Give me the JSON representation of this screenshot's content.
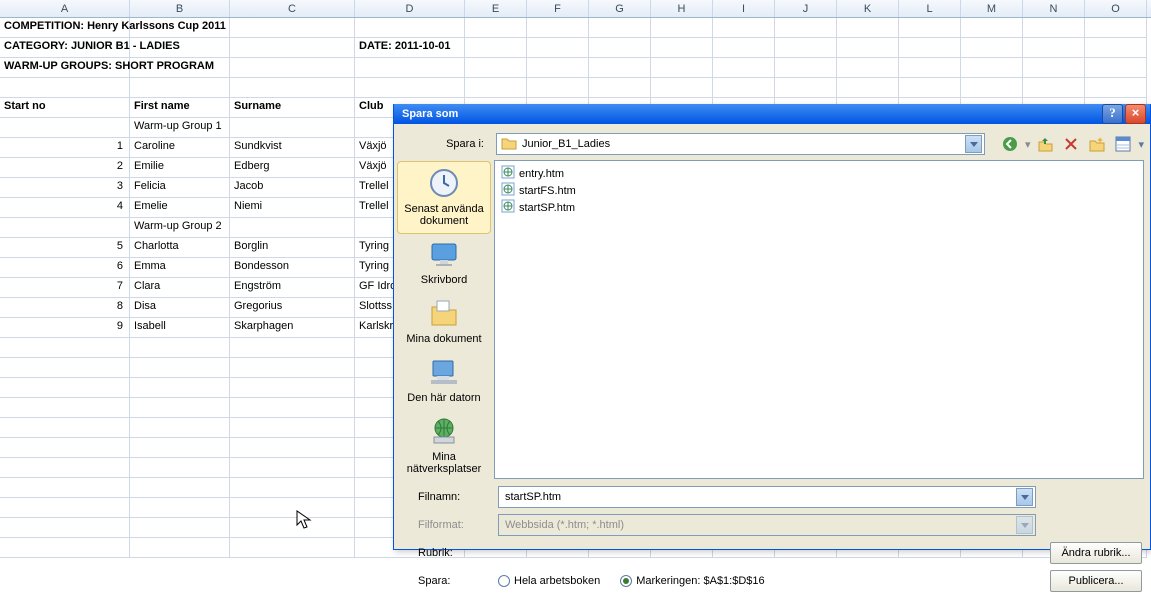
{
  "columns": [
    "A",
    "B",
    "C",
    "D",
    "E",
    "F",
    "G",
    "H",
    "I",
    "J",
    "K",
    "L",
    "M",
    "N",
    "O"
  ],
  "sheet": {
    "r1": {
      "a": "COMPETITION: Henry Karlssons Cup 2011"
    },
    "r2": {
      "a": "CATEGORY: JUNIOR B1 - LADIES",
      "d": "DATE: 2011-10-01"
    },
    "r3": {
      "a": "WARM-UP GROUPS: SHORT PROGRAM"
    },
    "hdr": {
      "a": "Start no",
      "b": "First name",
      "c": "Surname",
      "d": "Club"
    },
    "g1": "Warm-up Group 1",
    "g2": "Warm-up Group 2",
    "rows": [
      {
        "n": "1",
        "f": "Caroline",
        "s": "Sundkvist",
        "c": "Växjö"
      },
      {
        "n": "2",
        "f": "Emilie",
        "s": "Edberg",
        "c": "Växjö"
      },
      {
        "n": "3",
        "f": "Felicia",
        "s": "Jacob",
        "c": "Trellel"
      },
      {
        "n": "4",
        "f": "Emelie",
        "s": "Niemi",
        "c": "Trellel"
      },
      {
        "n": "5",
        "f": "Charlotta",
        "s": "Borglin",
        "c": "Tyring"
      },
      {
        "n": "6",
        "f": "Emma",
        "s": "Bondesson",
        "c": "Tyring"
      },
      {
        "n": "7",
        "f": "Clara",
        "s": "Engström",
        "c": "GF Idro"
      },
      {
        "n": "8",
        "f": "Disa",
        "s": "Gregorius",
        "c": "Slottss"
      },
      {
        "n": "9",
        "f": "Isabell",
        "s": "Skarphagen",
        "c": "Karlskr"
      }
    ]
  },
  "dialog": {
    "title": "Spara som",
    "savein_label": "Spara i:",
    "folder": "Junior_B1_Ladies",
    "places": {
      "recent": "Senast använda dokument",
      "desktop": "Skrivbord",
      "mydocs": "Mina dokument",
      "computer": "Den här datorn",
      "network": "Mina nätverksplatser"
    },
    "files": [
      "entry.htm",
      "startFS.htm",
      "startSP.htm"
    ],
    "filename_label": "Filnamn:",
    "filename": "startSP.htm",
    "format_label": "Filformat:",
    "format": "Webbsida (*.htm; *.html)",
    "rubrik_label": "Rubrik:",
    "andra_rubrik_btn": "Ändra rubrik...",
    "spara_label": "Spara:",
    "r_whole": "Hela arbetsboken",
    "r_sel": "Markeringen: $A$1:$D$16",
    "publish_btn": "Publicera..."
  }
}
